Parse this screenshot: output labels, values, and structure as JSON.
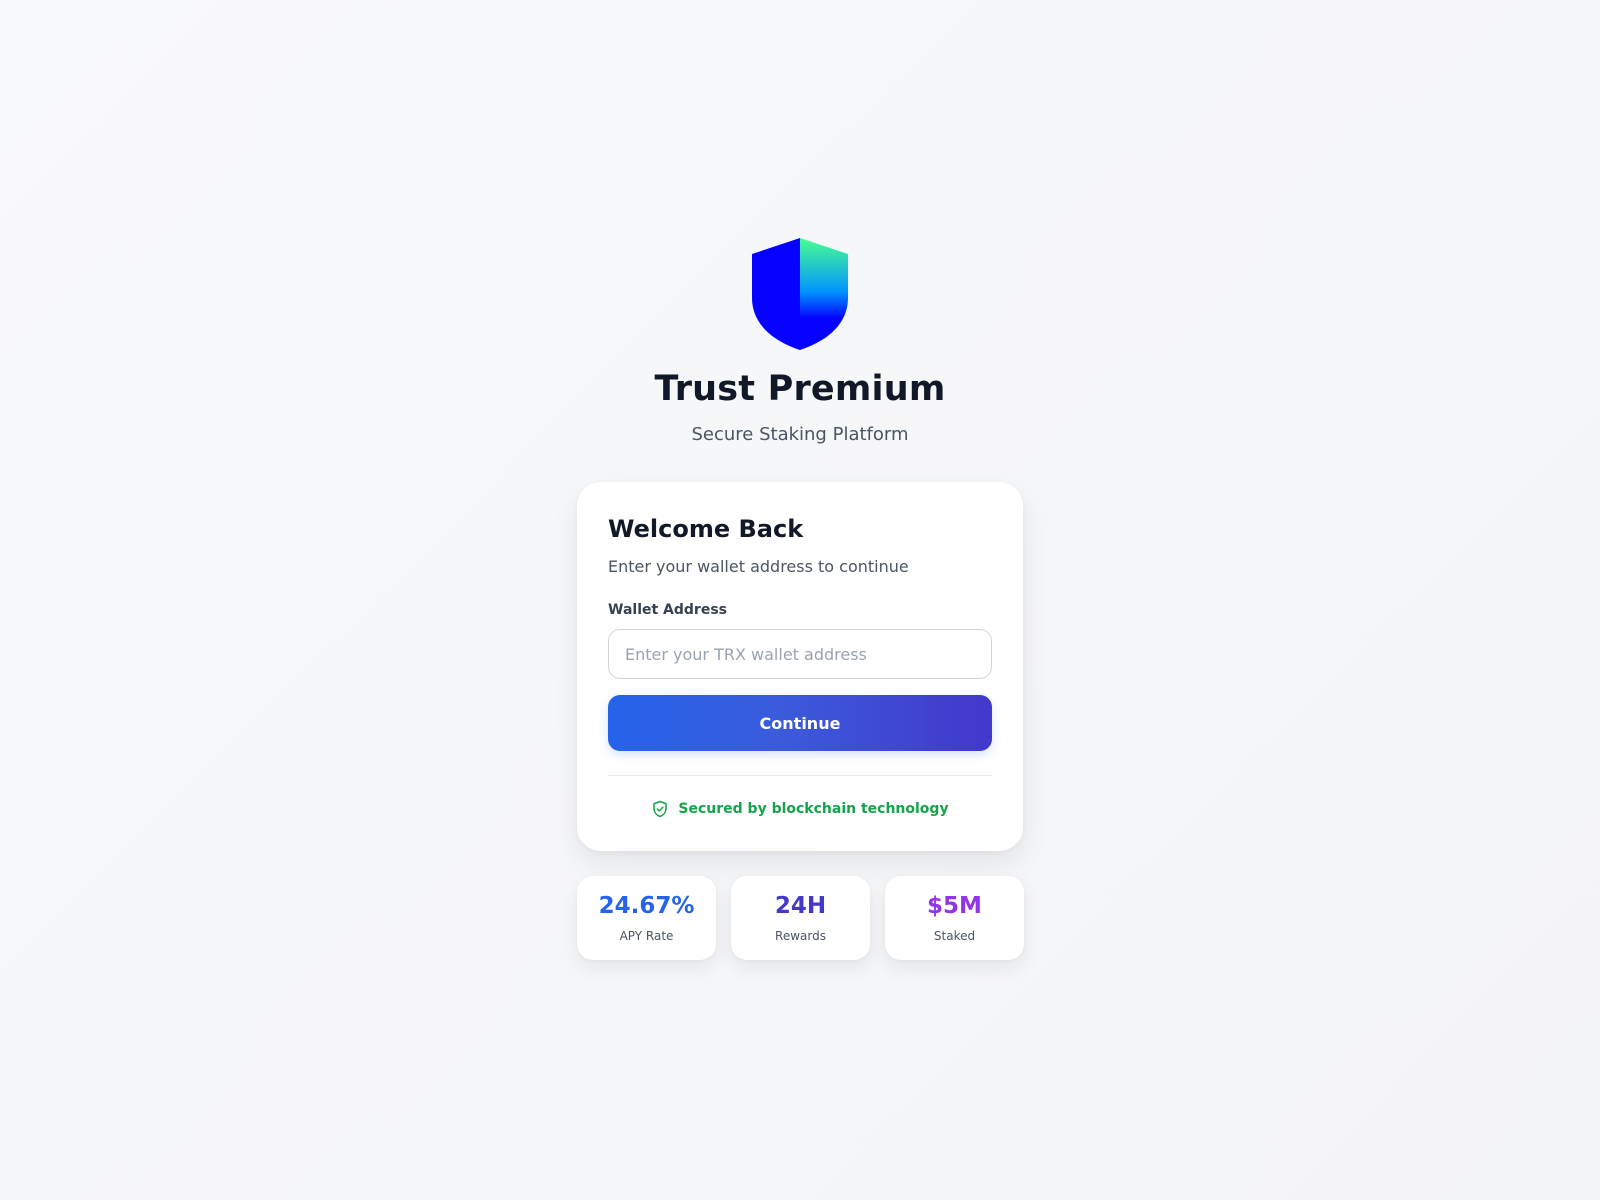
{
  "brand": {
    "title": "Trust Premium",
    "subtitle": "Secure Staking Platform",
    "logo_icon": "shield-logo-icon"
  },
  "login_card": {
    "title": "Welcome Back",
    "description": "Enter your wallet address to continue",
    "field_label": "Wallet Address",
    "input_value": "",
    "input_placeholder": "Enter your TRX wallet address",
    "button_label": "Continue",
    "security_icon": "shield-check-icon",
    "security_text": "Secured by blockchain technology"
  },
  "stats": [
    {
      "value": "24.67%",
      "label": "APY Rate",
      "color": "#2563eb"
    },
    {
      "value": "24H",
      "label": "Rewards",
      "color": "#4338ca"
    },
    {
      "value": "$5M",
      "label": "Staked",
      "color": "#9333ea"
    }
  ],
  "colors": {
    "logo_blue": "#0500ff",
    "logo_green": "#48ff91",
    "button_start": "#2563eb",
    "button_end": "#4338ca",
    "security_green": "#16a34a"
  }
}
